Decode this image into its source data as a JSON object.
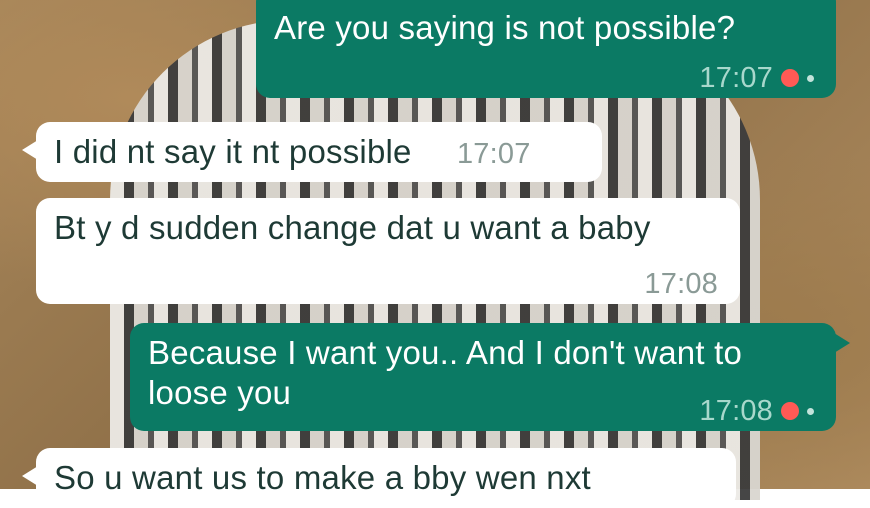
{
  "messages": [
    {
      "direction": "outgoing",
      "text": "Are you saying is not possible?",
      "time": "17:07",
      "status": "read-dot"
    },
    {
      "direction": "incoming",
      "text": "I did nt say it nt possible",
      "time": "17:07"
    },
    {
      "direction": "incoming",
      "text": "Bt y d sudden change dat u want a baby",
      "time": "17:08"
    },
    {
      "direction": "outgoing",
      "text": "Because I want you.. And I don't want to loose you",
      "time": "17:08",
      "status": "read-dot"
    },
    {
      "direction": "incoming",
      "text": "So u want us to make a bby wen nxt",
      "time": ""
    }
  ],
  "colors": {
    "outgoing_bubble": "#0b7a64",
    "incoming_bubble": "#ffffff",
    "status_dot": "#ff5a55"
  }
}
